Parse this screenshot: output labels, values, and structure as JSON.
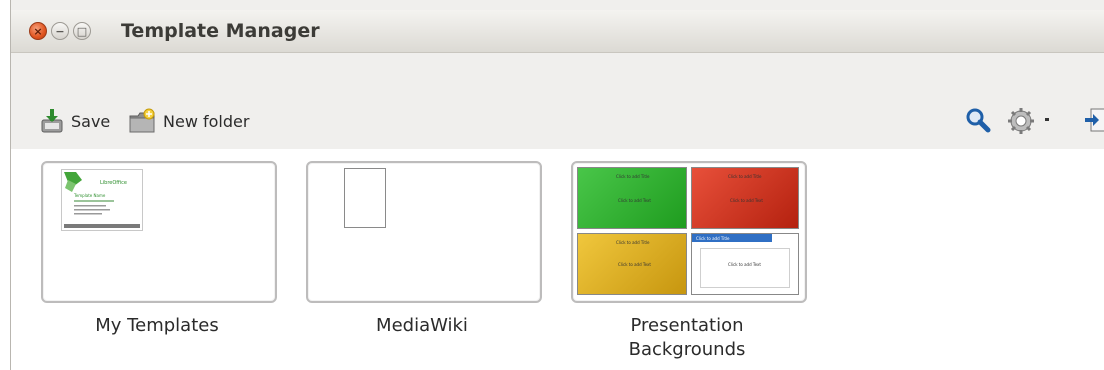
{
  "window": {
    "title": "Template Manager",
    "buttons": {
      "close": "×",
      "minimize": "−",
      "maximize": "□"
    }
  },
  "toolbar": {
    "save_label": "Save",
    "new_folder_label": "New folder"
  },
  "folders": [
    {
      "label": "My Templates"
    },
    {
      "label": "MediaWiki"
    },
    {
      "label_line1": "Presentation",
      "label_line2": "Backgrounds"
    }
  ],
  "previews": {
    "my_templates": {
      "brand": "LibreOffice",
      "heading": "Template Name"
    },
    "presentation_backgrounds": {
      "title_text": "Click to add Title",
      "body_text": "Click to add Text",
      "colors": [
        "#2bb22b",
        "#d9341a",
        "#d8a91a",
        "#ffffff"
      ]
    }
  },
  "colors": {
    "titlebar": "#e4e2dd",
    "close_button": "#e0541f",
    "accent_blue": "#1f5fa8"
  }
}
